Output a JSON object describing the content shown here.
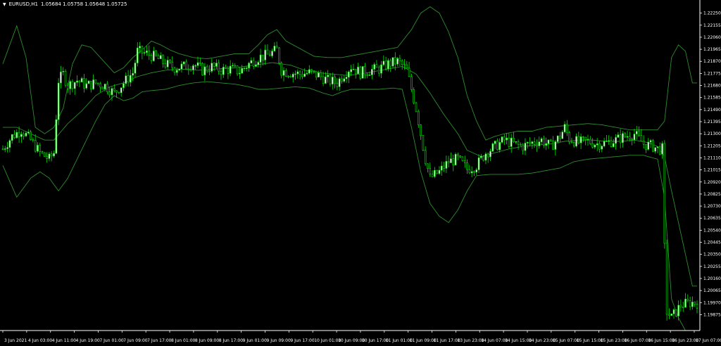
{
  "header": {
    "symbol": "EURUSD,H1",
    "ohlc": "1.05684 1.05758 1.05648 1.05725"
  },
  "chart_data": {
    "type": "candlestick",
    "ylim": [
      1.1975,
      1.2232
    ],
    "y_ticks": [
      "1.22250",
      "1.22155",
      "1.22060",
      "1.21965",
      "1.21870",
      "1.21775",
      "1.21680",
      "1.21585",
      "1.21490",
      "1.21395",
      "1.21300",
      "1.21205",
      "1.21110",
      "1.21015",
      "1.20920",
      "1.20825",
      "1.20730",
      "1.20635",
      "1.20540",
      "1.20445",
      "1.20350",
      "1.20255",
      "1.20160",
      "1.20065",
      "1.19970",
      "1.19875"
    ],
    "x_ticks": [
      "3 Jun 2021",
      "4 Jun 03:00",
      "4 Jun 11:00",
      "4 Jun 19:00",
      "7 Jun 01:00",
      "7 Jun 09:00",
      "7 Jun 17:00",
      "8 Jun 01:00",
      "8 Jun 09:00",
      "8 Jun 17:00",
      "9 Jun 01:00",
      "9 Jun 09:00",
      "9 Jun 17:00",
      "10 Jun 01:00",
      "10 Jun 09:00",
      "10 Jun 17:00",
      "11 Jun 01:00",
      "11 Jun 09:00",
      "11 Jun 17:00",
      "13 Jun 23:00",
      "14 Jun 07:00",
      "14 Jun 15:00",
      "14 Jun 23:00",
      "15 Jun 07:00",
      "15 Jun 15:00",
      "15 Jun 23:00",
      "16 Jun 07:00",
      "16 Jun 15:00",
      "16 Jun 23:00",
      "17 Jun 07:00"
    ],
    "close_anchors": [
      [
        0,
        1.2118
      ],
      [
        4,
        1.2128
      ],
      [
        8,
        1.2133
      ],
      [
        12,
        1.2125
      ],
      [
        16,
        1.2115
      ],
      [
        20,
        1.211
      ],
      [
        22,
        1.2115
      ],
      [
        24,
        1.2172
      ],
      [
        26,
        1.2177
      ],
      [
        28,
        1.2168
      ],
      [
        32,
        1.2172
      ],
      [
        36,
        1.2168
      ],
      [
        40,
        1.217
      ],
      [
        44,
        1.2168
      ],
      [
        48,
        1.2162
      ],
      [
        52,
        1.217
      ],
      [
        56,
        1.2178
      ],
      [
        58,
        1.2195
      ],
      [
        62,
        1.2193
      ],
      [
        66,
        1.219
      ],
      [
        70,
        1.2185
      ],
      [
        74,
        1.2182
      ],
      [
        78,
        1.2183
      ],
      [
        82,
        1.2185
      ],
      [
        86,
        1.218
      ],
      [
        90,
        1.2183
      ],
      [
        94,
        1.218
      ],
      [
        98,
        1.2181
      ],
      [
        102,
        1.2179
      ],
      [
        106,
        1.2185
      ],
      [
        110,
        1.219
      ],
      [
        114,
        1.2192
      ],
      [
        118,
        1.2196
      ],
      [
        120,
        1.218
      ],
      [
        124,
        1.2178
      ],
      [
        128,
        1.2177
      ],
      [
        132,
        1.2178
      ],
      [
        136,
        1.2176
      ],
      [
        140,
        1.2172
      ],
      [
        144,
        1.217
      ],
      [
        146,
        1.2175
      ],
      [
        150,
        1.2183
      ],
      [
        154,
        1.2178
      ],
      [
        158,
        1.218
      ],
      [
        162,
        1.2181
      ],
      [
        166,
        1.2185
      ],
      [
        170,
        1.2187
      ],
      [
        172,
        1.2184
      ],
      [
        174,
        1.218
      ],
      [
        176,
        1.2165
      ],
      [
        178,
        1.215
      ],
      [
        180,
        1.213
      ],
      [
        182,
        1.211
      ],
      [
        184,
        1.2095
      ],
      [
        188,
        1.21
      ],
      [
        192,
        1.2108
      ],
      [
        196,
        1.211
      ],
      [
        200,
        1.2102
      ],
      [
        204,
        1.2105
      ],
      [
        208,
        1.2115
      ],
      [
        212,
        1.212
      ],
      [
        216,
        1.2125
      ],
      [
        220,
        1.2122
      ],
      [
        224,
        1.212
      ],
      [
        228,
        1.2123
      ],
      [
        232,
        1.2125
      ],
      [
        236,
        1.212
      ],
      [
        240,
        1.2128
      ],
      [
        242,
        1.2135
      ],
      [
        244,
        1.2126
      ],
      [
        248,
        1.2123
      ],
      [
        252,
        1.2124
      ],
      [
        256,
        1.2122
      ],
      [
        260,
        1.2123
      ],
      [
        264,
        1.2125
      ],
      [
        268,
        1.2128
      ],
      [
        272,
        1.213
      ],
      [
        276,
        1.2122
      ],
      [
        280,
        1.212
      ],
      [
        282,
        1.2118
      ],
      [
        284,
        1.2118
      ],
      [
        285,
        1.204
      ],
      [
        286,
        1.199
      ],
      [
        288,
        1.1985
      ],
      [
        292,
        1.1995
      ],
      [
        296,
        1.1997
      ]
    ],
    "bollinger": {
      "upper": [
        [
          0,
          1.2185
        ],
        [
          6,
          1.2215
        ],
        [
          10,
          1.219
        ],
        [
          14,
          1.2135
        ],
        [
          18,
          1.213
        ],
        [
          22,
          1.2135
        ],
        [
          26,
          1.215
        ],
        [
          30,
          1.2185
        ],
        [
          34,
          1.22
        ],
        [
          38,
          1.2198
        ],
        [
          42,
          1.219
        ],
        [
          48,
          1.2178
        ],
        [
          52,
          1.2182
        ],
        [
          56,
          1.219
        ],
        [
          60,
          1.2196
        ],
        [
          64,
          1.2203
        ],
        [
          68,
          1.22
        ],
        [
          72,
          1.2196
        ],
        [
          76,
          1.2193
        ],
        [
          82,
          1.219
        ],
        [
          88,
          1.2189
        ],
        [
          94,
          1.2191
        ],
        [
          100,
          1.2193
        ],
        [
          106,
          1.2193
        ],
        [
          110,
          1.22
        ],
        [
          114,
          1.2208
        ],
        [
          118,
          1.2212
        ],
        [
          122,
          1.2203
        ],
        [
          128,
          1.2197
        ],
        [
          134,
          1.2191
        ],
        [
          140,
          1.219
        ],
        [
          146,
          1.219
        ],
        [
          152,
          1.2192
        ],
        [
          158,
          1.2194
        ],
        [
          164,
          1.2196
        ],
        [
          170,
          1.2198
        ],
        [
          176,
          1.2212
        ],
        [
          180,
          1.2225
        ],
        [
          184,
          1.223
        ],
        [
          188,
          1.2225
        ],
        [
          192,
          1.221
        ],
        [
          196,
          1.219
        ],
        [
          200,
          1.216
        ],
        [
          204,
          1.214
        ],
        [
          208,
          1.2125
        ],
        [
          212,
          1.2128
        ],
        [
          216,
          1.213
        ],
        [
          222,
          1.2132
        ],
        [
          228,
          1.2132
        ],
        [
          234,
          1.2135
        ],
        [
          240,
          1.2136
        ],
        [
          246,
          1.2137
        ],
        [
          252,
          1.2138
        ],
        [
          258,
          1.2137
        ],
        [
          264,
          1.2135
        ],
        [
          270,
          1.2133
        ],
        [
          276,
          1.2133
        ],
        [
          282,
          1.2133
        ],
        [
          285,
          1.214
        ],
        [
          288,
          1.219
        ],
        [
          291,
          1.22
        ],
        [
          294,
          1.2195
        ],
        [
          297,
          1.217
        ]
      ],
      "middle": [
        [
          0,
          1.2135
        ],
        [
          6,
          1.2135
        ],
        [
          12,
          1.213
        ],
        [
          18,
          1.2125
        ],
        [
          22,
          1.2125
        ],
        [
          28,
          1.2138
        ],
        [
          34,
          1.2148
        ],
        [
          40,
          1.216
        ],
        [
          46,
          1.2167
        ],
        [
          52,
          1.217
        ],
        [
          58,
          1.2175
        ],
        [
          64,
          1.2178
        ],
        [
          70,
          1.218
        ],
        [
          76,
          1.2181
        ],
        [
          84,
          1.218
        ],
        [
          92,
          1.2181
        ],
        [
          100,
          1.2182
        ],
        [
          108,
          1.2184
        ],
        [
          116,
          1.2186
        ],
        [
          124,
          1.2184
        ],
        [
          130,
          1.218
        ],
        [
          136,
          1.2178
        ],
        [
          142,
          1.2177
        ],
        [
          148,
          1.2176
        ],
        [
          154,
          1.2177
        ],
        [
          160,
          1.2179
        ],
        [
          166,
          1.2181
        ],
        [
          172,
          1.2183
        ],
        [
          178,
          1.2177
        ],
        [
          184,
          1.2162
        ],
        [
          190,
          1.2145
        ],
        [
          196,
          1.213
        ],
        [
          200,
          1.2117
        ],
        [
          206,
          1.2112
        ],
        [
          212,
          1.2115
        ],
        [
          218,
          1.2118
        ],
        [
          224,
          1.212
        ],
        [
          230,
          1.2121
        ],
        [
          236,
          1.2122
        ],
        [
          242,
          1.2124
        ],
        [
          248,
          1.2125
        ],
        [
          254,
          1.2125
        ],
        [
          260,
          1.2124
        ],
        [
          266,
          1.2124
        ],
        [
          272,
          1.2125
        ],
        [
          278,
          1.2123
        ],
        [
          282,
          1.212
        ],
        [
          285,
          1.2112
        ],
        [
          288,
          1.2085
        ],
        [
          291,
          1.206
        ],
        [
          294,
          1.2035
        ],
        [
          297,
          1.201
        ]
      ],
      "lower": [
        [
          0,
          1.2105
        ],
        [
          6,
          1.208
        ],
        [
          12,
          1.2095
        ],
        [
          16,
          1.21
        ],
        [
          20,
          1.2095
        ],
        [
          24,
          1.2085
        ],
        [
          28,
          1.2095
        ],
        [
          32,
          1.211
        ],
        [
          36,
          1.2125
        ],
        [
          40,
          1.214
        ],
        [
          44,
          1.2153
        ],
        [
          48,
          1.216
        ],
        [
          52,
          1.2156
        ],
        [
          56,
          1.2158
        ],
        [
          60,
          1.2163
        ],
        [
          64,
          1.2164
        ],
        [
          70,
          1.2165
        ],
        [
          76,
          1.2168
        ],
        [
          82,
          1.217
        ],
        [
          88,
          1.2171
        ],
        [
          94,
          1.217
        ],
        [
          100,
          1.2169
        ],
        [
          106,
          1.2167
        ],
        [
          110,
          1.2165
        ],
        [
          114,
          1.2165
        ],
        [
          120,
          1.2166
        ],
        [
          126,
          1.2167
        ],
        [
          132,
          1.2166
        ],
        [
          138,
          1.2162
        ],
        [
          142,
          1.216
        ],
        [
          146,
          1.2163
        ],
        [
          150,
          1.2165
        ],
        [
          156,
          1.2165
        ],
        [
          162,
          1.2165
        ],
        [
          168,
          1.2166
        ],
        [
          172,
          1.2165
        ],
        [
          176,
          1.2135
        ],
        [
          180,
          1.21
        ],
        [
          184,
          1.2075
        ],
        [
          188,
          1.2065
        ],
        [
          192,
          1.206
        ],
        [
          196,
          1.207
        ],
        [
          200,
          1.2085
        ],
        [
          204,
          1.2097
        ],
        [
          210,
          1.2098
        ],
        [
          216,
          1.2098
        ],
        [
          222,
          1.2098
        ],
        [
          228,
          1.2099
        ],
        [
          234,
          1.2101
        ],
        [
          240,
          1.2103
        ],
        [
          246,
          1.2108
        ],
        [
          252,
          1.211
        ],
        [
          258,
          1.2111
        ],
        [
          264,
          1.2112
        ],
        [
          270,
          1.2113
        ],
        [
          276,
          1.2113
        ],
        [
          282,
          1.211
        ],
        [
          285,
          1.208
        ],
        [
          288,
          1.2
        ],
        [
          291,
          1.1985
        ],
        [
          294,
          1.1975
        ],
        [
          297,
          1.1975
        ]
      ]
    },
    "grid": false,
    "candle_color": "#e6ffe6",
    "wick_color": "#00e600",
    "band_color": "#2e8b2e",
    "background": "#000000",
    "axis_color": "#ffffff"
  }
}
